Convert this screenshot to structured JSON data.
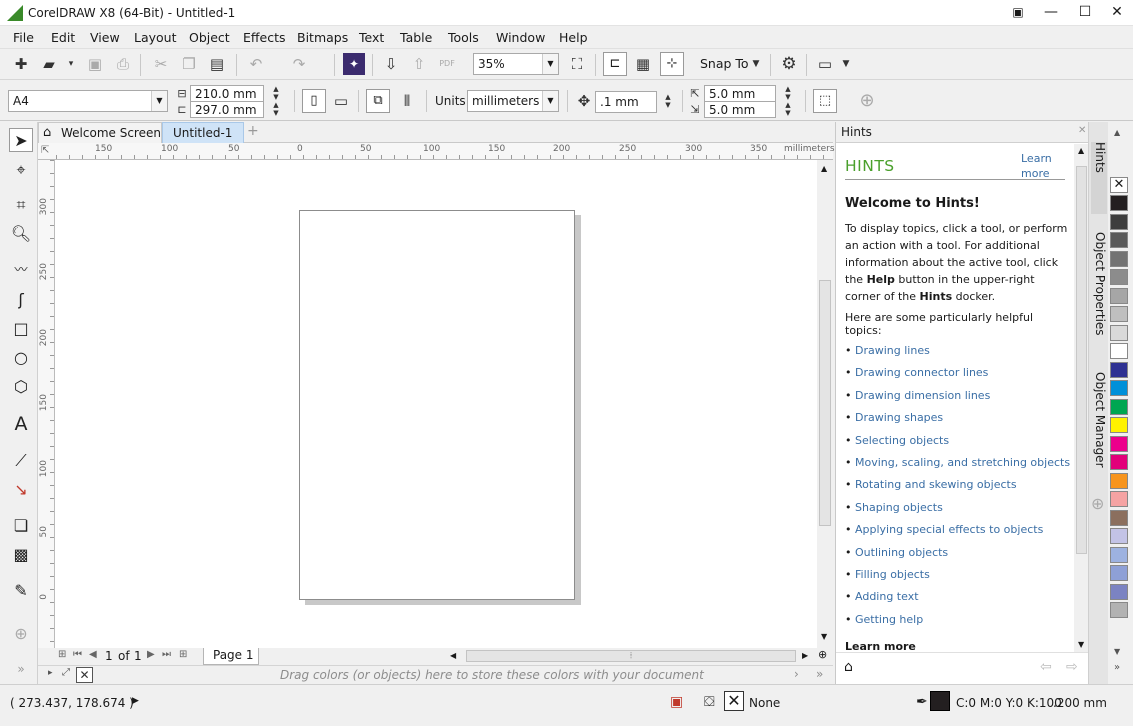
{
  "window": {
    "title": "CorelDRAW X8 (64-Bit) - Untitled-1"
  },
  "menu": [
    "File",
    "Edit",
    "View",
    "Layout",
    "Object",
    "Effects",
    "Bitmaps",
    "Text",
    "Table",
    "Tools",
    "Window",
    "Help"
  ],
  "toolbar": {
    "zoom": "35%",
    "snap_to": "Snap To"
  },
  "propbar": {
    "page_size": "A4",
    "width": "210.0 mm",
    "height": "297.0 mm",
    "units_label": "Units:",
    "units_value": "millimeters",
    "nudge": ".1 mm",
    "dup_x": "5.0 mm",
    "dup_y": "5.0 mm"
  },
  "tabs": {
    "welcome": "Welcome Screen",
    "doc": "Untitled-1"
  },
  "ruler": {
    "h_ticks": [
      "150",
      "100",
      "50",
      "0",
      "50",
      "100",
      "150",
      "200",
      "250",
      "300",
      "350"
    ],
    "unit": "millimeters",
    "v_ticks": [
      "300",
      "250",
      "200",
      "150",
      "100",
      "50",
      "0"
    ]
  },
  "pagenav": {
    "current": "1",
    "of": "of",
    "total": "1",
    "page_tab": "Page 1"
  },
  "colortray": {
    "hint": "Drag colors (or objects) here to store these colors with your document"
  },
  "hints": {
    "panel_label": "Hints",
    "title": "HINTS",
    "learn_more_link": "Learn more",
    "welcome": "Welcome to Hints!",
    "description_1": "To display topics, click a tool, or perform an action with a tool. For additional information about the active tool, click the ",
    "description_help": "Help",
    "description_2": " button in the upper-right corner of the ",
    "description_hints": "Hints",
    "description_3": " docker.",
    "topics_intro": "Here are some particularly helpful topics:",
    "topics": [
      "Drawing lines",
      "Drawing connector lines",
      "Drawing dimension lines",
      "Drawing shapes",
      "Selecting objects",
      "Moving, scaling, and stretching objects",
      "Rotating and skewing objects",
      "Shaping objects",
      "Applying special effects to objects",
      "Outlining objects",
      "Filling objects",
      "Adding text",
      "Getting help"
    ],
    "footer_title": "Learn more"
  },
  "docker_tabs": [
    "Hints",
    "Object Properties",
    "Object Manager"
  ],
  "palette": [
    "#231f20",
    "#3d3d3d",
    "#5a5a5a",
    "#737373",
    "#8c8c8c",
    "#a6a6a6",
    "#bfbfbf",
    "#d9d9d9",
    "#ffffff",
    "#2e3192",
    "#0090d9",
    "#00a651",
    "#fff200",
    "#ec008c",
    "#e2007a",
    "#f7941d",
    "#f5a3a3",
    "#8b6f5e",
    "#c3c3e6",
    "#9db2e0",
    "#8ea0d6",
    "#7b83c2",
    "#b2b2b2"
  ],
  "status": {
    "coords": "( 273.437, 178.674 )",
    "fill_label": "None",
    "outline_color": "C:0 M:0 Y:0 K:100",
    "outline_width": ".200 mm"
  }
}
